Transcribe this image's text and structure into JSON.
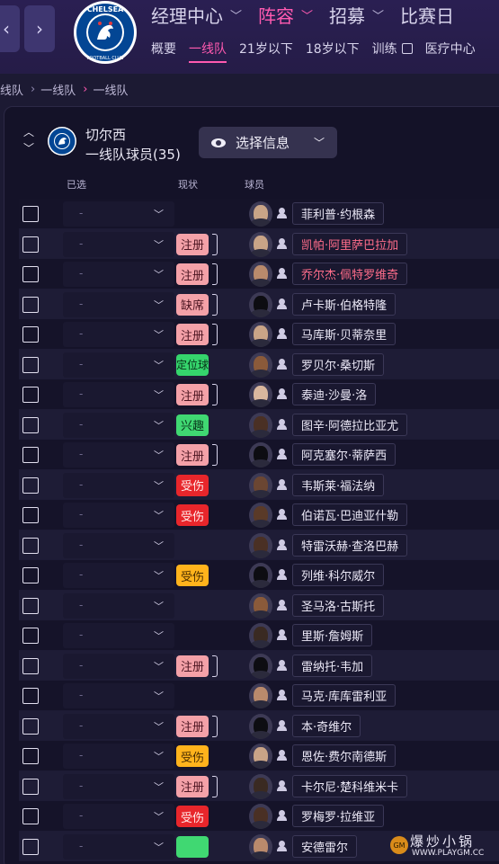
{
  "header": {
    "back_icon": "chevron-left-icon",
    "forward_icon": "chevron-right-icon",
    "club_crest_text": "CHELSEA FOOTBALL CLUB",
    "main_nav": [
      {
        "label": "经理中心",
        "active": false
      },
      {
        "label": "阵容",
        "active": true
      },
      {
        "label": "招募",
        "active": false
      },
      {
        "label": "比赛日",
        "active": false
      }
    ],
    "sub_nav": [
      {
        "label": "概要",
        "active": false
      },
      {
        "label": "一线队",
        "active": true
      },
      {
        "label": "21岁以下",
        "active": false
      },
      {
        "label": "18岁以下",
        "active": false
      },
      {
        "label": "训练",
        "active": false,
        "external": true
      },
      {
        "label": "医疗中心",
        "active": false
      }
    ]
  },
  "breadcrumb": [
    "线队",
    "一线队",
    "一线队"
  ],
  "panel": {
    "club_name": "切尔西",
    "squad_label": "一线队球员(35)",
    "select_info_label": "选择信息"
  },
  "columns": {
    "selected": "已选",
    "status": "现状",
    "player": "球员"
  },
  "dropdown_placeholder": "-",
  "colors": {
    "accent": "#ff5ab0",
    "registered": "#f4a1a8",
    "injured": "#e8262b",
    "interest": "#40d872",
    "minor_injury": "#ffb31c"
  },
  "players": [
    {
      "name": "菲利普·约根森",
      "status": "",
      "status_type": "none",
      "highlight": false,
      "skin": "#c9a487"
    },
    {
      "name": "凯帕·阿里萨巴拉加",
      "status": "注册",
      "status_type": "reg",
      "highlight": true,
      "skin": "#c9a487"
    },
    {
      "name": "乔尔杰·佩特罗维奇",
      "status": "注册",
      "status_type": "reg",
      "highlight": true,
      "skin": "#b98a6c"
    },
    {
      "name": "卢卡斯·伯格特隆",
      "status": "缺席",
      "status_type": "abs",
      "highlight": false,
      "skin": "#0d0d12"
    },
    {
      "name": "马库斯·贝蒂奈里",
      "status": "注册",
      "status_type": "reg",
      "highlight": false,
      "skin": "#c9a487"
    },
    {
      "name": "罗贝尔·桑切斯",
      "status": "定位球",
      "status_type": "set",
      "highlight": false,
      "skin": "#8a5a3a"
    },
    {
      "name": "泰迪·沙曼·洛",
      "status": "注册",
      "status_type": "reg",
      "highlight": false,
      "skin": "#d9b79e"
    },
    {
      "name": "图辛·阿德拉比亚尤",
      "status": "兴趣",
      "status_type": "int",
      "highlight": false,
      "skin": "#4a3024"
    },
    {
      "name": "阿克塞尔·蒂萨西",
      "status": "注册",
      "status_type": "reg",
      "highlight": false,
      "skin": "#0d0d12"
    },
    {
      "name": "韦斯莱·福法纳",
      "status": "受伤",
      "status_type": "inj",
      "highlight": false,
      "skin": "#6b4632"
    },
    {
      "name": "伯诺瓦·巴迪亚什勒",
      "status": "受伤",
      "status_type": "inj",
      "highlight": false,
      "skin": "#5a3a28"
    },
    {
      "name": "特雷沃赫·查洛巴赫",
      "status": "",
      "status_type": "none",
      "highlight": false,
      "skin": "#4a3024"
    },
    {
      "name": "列维·科尔威尔",
      "status": "受伤",
      "status_type": "inj2",
      "highlight": false,
      "skin": "#0d0d12"
    },
    {
      "name": "圣马洛·古斯托",
      "status": "",
      "status_type": "none",
      "highlight": false,
      "skin": "#8a5a3a"
    },
    {
      "name": "里斯·詹姆斯",
      "status": "",
      "status_type": "none",
      "highlight": false,
      "skin": "#3a2a22"
    },
    {
      "name": "雷纳托·韦加",
      "status": "注册",
      "status_type": "reg",
      "highlight": false,
      "skin": "#0d0d12"
    },
    {
      "name": "马克·库库雷利亚",
      "status": "",
      "status_type": "none",
      "highlight": false,
      "skin": "#b98a6c"
    },
    {
      "name": "本·奇维尔",
      "status": "注册",
      "status_type": "reg",
      "highlight": false,
      "skin": "#0d0d12"
    },
    {
      "name": "恩佐·费尔南德斯",
      "status": "受伤",
      "status_type": "inj2",
      "highlight": false,
      "skin": "#c9a487"
    },
    {
      "name": "卡尔尼·楚科维米卡",
      "status": "注册",
      "status_type": "reg",
      "highlight": false,
      "skin": "#3a2a22"
    },
    {
      "name": "罗梅罗·拉维亚",
      "status": "受伤",
      "status_type": "inj",
      "highlight": false,
      "skin": "#4a3024"
    },
    {
      "name": "安德雷尔",
      "status": "",
      "status_type": "int",
      "highlight": false,
      "skin": "#b98a6c"
    }
  ],
  "watermark": {
    "text": "爆炒小锅",
    "url": "WWW.PLAYGM.CC"
  }
}
